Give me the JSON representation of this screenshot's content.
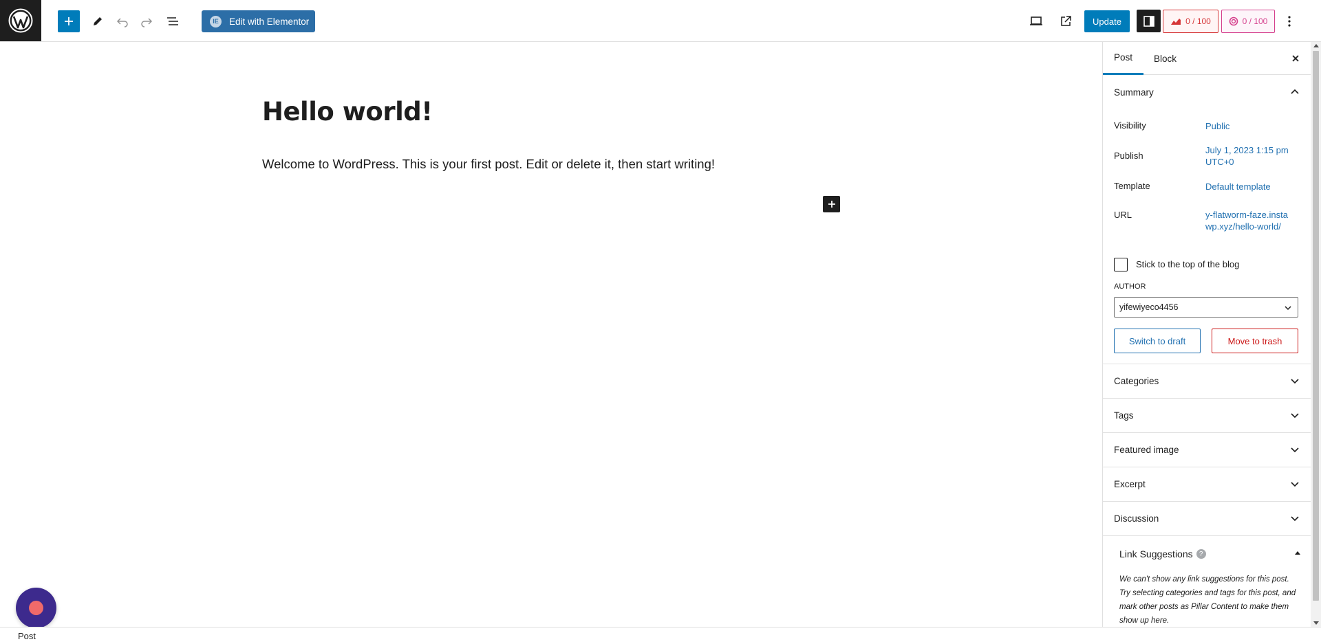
{
  "toolbar": {
    "elementor_label": "Edit with Elementor",
    "update_label": "Update",
    "seo_score": "0 / 100",
    "readability_score": "0 / 100"
  },
  "post": {
    "title": "Hello world!",
    "paragraph": "Welcome to WordPress. This is your first post. Edit or delete it, then start writing!"
  },
  "footer": {
    "label": "Post"
  },
  "sidebar": {
    "tabs": [
      {
        "label": "Post"
      },
      {
        "label": "Block"
      }
    ],
    "summary": {
      "heading": "Summary",
      "visibility_label": "Visibility",
      "visibility_value": "Public",
      "publish_label": "Publish",
      "publish_value": "July 1, 2023 1:15 pm UTC+0",
      "template_label": "Template",
      "template_value": "Default template",
      "url_label": "URL",
      "url_value": "y-flatworm-faze.instawp.xyz/hello-world/",
      "sticky_label": "Stick to the top of the blog",
      "author_label": "AUTHOR",
      "author_value": "yifewiyeco4456",
      "switch_draft": "Switch to draft",
      "move_trash": "Move to trash"
    },
    "panels": [
      {
        "label": "Categories"
      },
      {
        "label": "Tags"
      },
      {
        "label": "Featured image"
      },
      {
        "label": "Excerpt"
      },
      {
        "label": "Discussion"
      }
    ],
    "link_suggestions": {
      "heading": "Link Suggestions",
      "text": "We can't show any link suggestions for this post. Try selecting categories and tags for this post, and mark other posts as Pillar Content to make them show up here."
    }
  },
  "colors": {
    "accent": "#007cba",
    "link": "#2271b1",
    "danger": "#cc1818",
    "seo": "#d63638",
    "readability": "#d5408d",
    "chat": "#3d2a8d"
  }
}
